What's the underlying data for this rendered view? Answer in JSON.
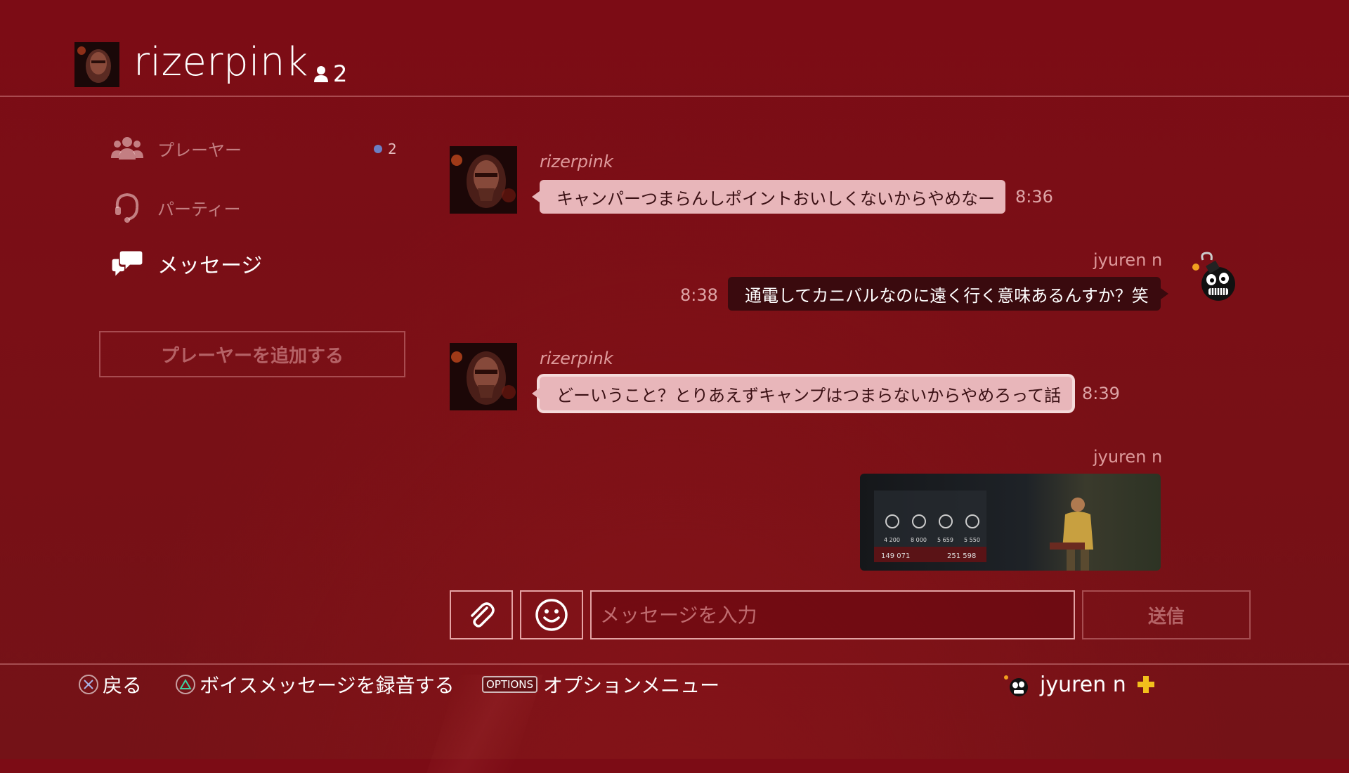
{
  "header": {
    "title": "rizerpink",
    "member_count": "2"
  },
  "sidebar": {
    "items": [
      {
        "label": "プレーヤー",
        "badge": "2"
      },
      {
        "label": "パーティー"
      },
      {
        "label": "メッセージ",
        "active": true
      }
    ],
    "add_player_label": "プレーヤーを追加する"
  },
  "messages": [
    {
      "sender": "rizerpink",
      "text": "キャンパーつまらんしポイントおいしくないからやめなー",
      "time": "8:36",
      "direction": "in"
    },
    {
      "sender": "jyuren n",
      "text": "通電してカニバルなのに遠く行く意味あるんすか？笑",
      "time": "8:38",
      "direction": "out"
    },
    {
      "sender": "rizerpink",
      "text": "どーいうこと？とりあえずキャンプはつまらないからやめろって話",
      "time": "8:39",
      "direction": "in",
      "focused": true
    },
    {
      "sender": "jyuren n",
      "direction": "out",
      "attachment": "screenshot",
      "screenshot_stats": [
        "4 200",
        "8 000",
        "5 659",
        "5 550"
      ],
      "screenshot_totals": [
        "149 071",
        "251 598"
      ]
    }
  ],
  "composer": {
    "placeholder": "メッセージを入力",
    "send_label": "送信"
  },
  "footer": {
    "back_label": "戻る",
    "voice_label": "ボイスメッセージを録音する",
    "options_key": "OPTIONS",
    "options_label": "オプションメニュー",
    "user_name": "jyuren n"
  },
  "colors": {
    "background": "#7c0c15",
    "incoming_bubble": "#e8b6ba",
    "outgoing_bubble": "#3a0a0e",
    "plus_gold": "#f2c01c",
    "badge_dot": "#6b7fc4"
  },
  "icons": {
    "players": "people-icon",
    "party": "headset-icon",
    "messages": "speech-bubbles-icon",
    "attach": "paperclip-icon",
    "emoji": "smiley-icon",
    "cross": "cross-button-icon",
    "triangle": "triangle-button-icon",
    "plus": "ps-plus-icon"
  }
}
